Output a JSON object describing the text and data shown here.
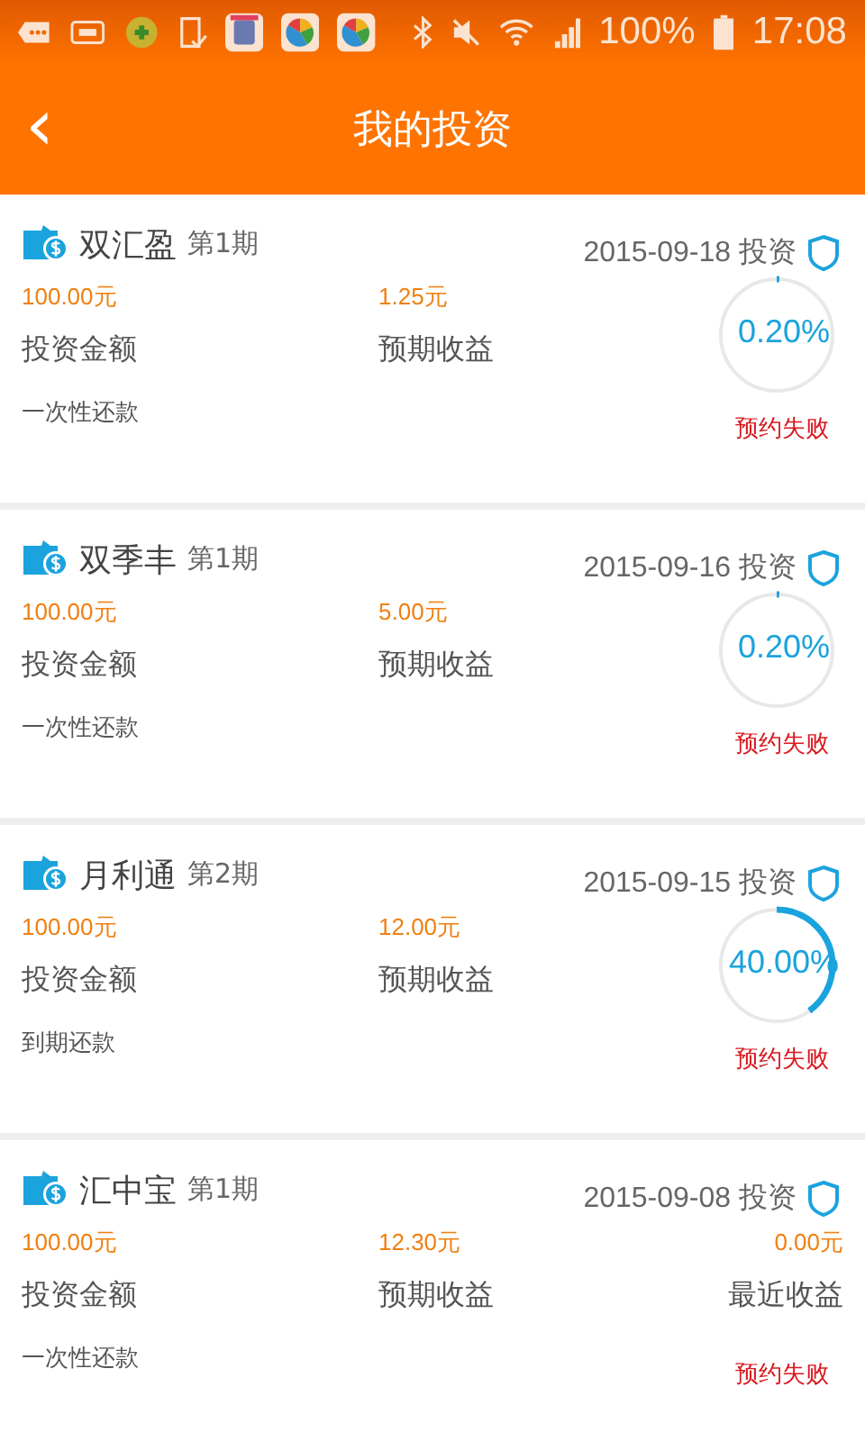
{
  "status_bar": {
    "battery": "100%",
    "time": "17:08"
  },
  "header": {
    "title": "我的投资",
    "back": "‹"
  },
  "investments": [
    {
      "kind": "progress",
      "name": "双汇盈",
      "period": "第1期",
      "date": "2015-09-18 投资",
      "amount": "100.00元",
      "amount_label": "投资金额",
      "expected": "1.25元",
      "expected_label": "预期收益",
      "repayment": "一次性还款",
      "level": 0.002,
      "percent": "0.20%",
      "status": "预约失败"
    },
    {
      "kind": "progress",
      "name": "双季丰",
      "period": "第1期",
      "date": "2015-09-16 投资",
      "amount": "100.00元",
      "amount_label": "投资金额",
      "expected": "5.00元",
      "expected_label": "预期收益",
      "repayment": "一次性还款",
      "level": 0.002,
      "percent": "0.20%",
      "status": "预约失败"
    },
    {
      "kind": "progress",
      "name": "月利通",
      "period": "第2期",
      "date": "2015-09-15 投资",
      "amount": "100.00元",
      "amount_label": "投资金额",
      "expected": "12.00元",
      "expected_label": "预期收益",
      "repayment": "到期还款",
      "level": 0.4,
      "percent": "40.00%",
      "status": "预约失败"
    },
    {
      "kind": "earnings",
      "name": "汇中宝",
      "period": "第1期",
      "date": "2015-09-08 投资",
      "amount": "100.00元",
      "amount_label": "投资金额",
      "expected": "12.30元",
      "expected_label": "预期收益",
      "recent": "0.00元",
      "recent_label": "最近收益",
      "repayment": "一次性还款",
      "status": "预约失败"
    }
  ]
}
